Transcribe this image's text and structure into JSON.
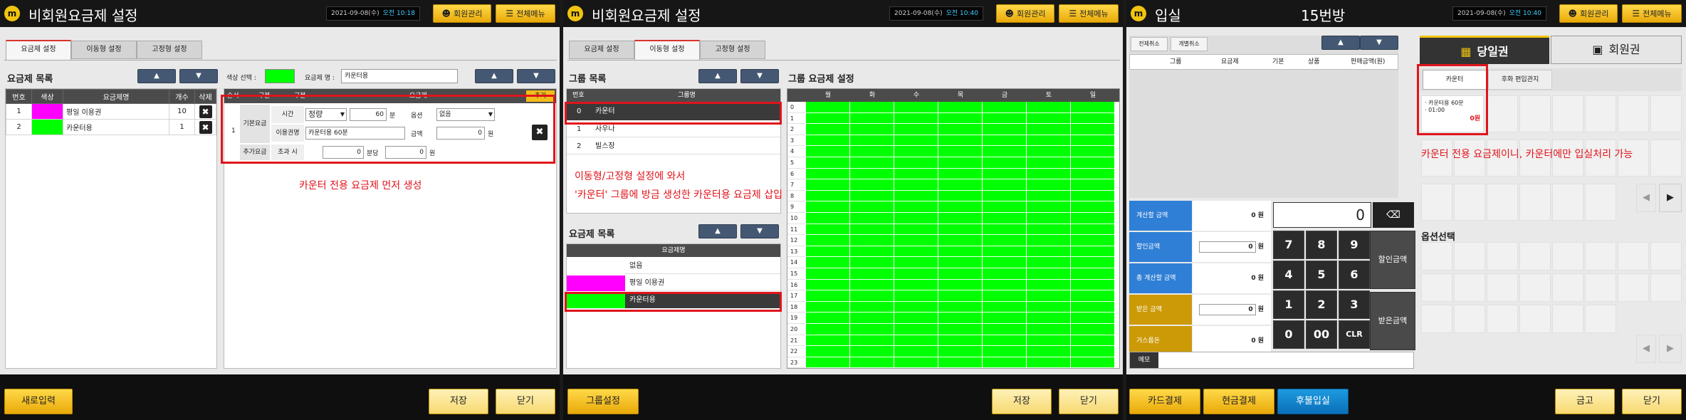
{
  "header": {
    "date": "2021-09-08(수)",
    "ampm": "오전",
    "btn_members": "회원관리",
    "btn_menu": "전체메뉴",
    "member_icon": "person-icon",
    "menu_icon": "hamburger-icon"
  },
  "p1": {
    "title": "비회원요금제 설정",
    "time": "10:18",
    "tabs": [
      "요금제 설정",
      "이동형 설정",
      "고정형 설정"
    ],
    "list_title": "요금제 목록",
    "list_headers": [
      "번호",
      "색상",
      "요금제명",
      "개수",
      "삭제"
    ],
    "list_rows": [
      {
        "no": "1",
        "color": "#ff00ff",
        "name": "평일 이용권",
        "count": "10"
      },
      {
        "no": "2",
        "color": "#00ff00",
        "name": "카운터용",
        "count": "1"
      }
    ],
    "color_label": "색상 선택 :",
    "color_value": "#00ff00",
    "name_label": "요금제 명 :",
    "name_value": "카운터용",
    "detail_headers": [
      "순서",
      "구분",
      "구분",
      "요금제"
    ],
    "add_btn": "추가",
    "row_no": "1",
    "base_fee": "기본요금",
    "time_label": "시간",
    "time_type": "정량",
    "time_value": "60",
    "time_unit": "분",
    "option_label": "옵션",
    "option_value": "없음",
    "name2_label": "이용권명",
    "name2_value": "카운터용 60분",
    "price_label": "금액",
    "price_value": "0",
    "won": "원",
    "extra_label": "추가요금",
    "over_label": "초과 시",
    "over_value": "0",
    "per_min": "분당",
    "extra_value": "0",
    "annotation": "카운터 전용 요금제 먼저 생성",
    "btn_new": "새로입력",
    "btn_save": "저장",
    "btn_close": "닫기"
  },
  "p2": {
    "title": "비회원요금제 설정",
    "time": "10:40",
    "tabs": [
      "요금제 설정",
      "이동형 설정",
      "고정형 설정"
    ],
    "group_title": "그룹 목록",
    "group_headers": [
      "번호",
      "그룹명"
    ],
    "groups": [
      {
        "no": "0",
        "name": "카운터"
      },
      {
        "no": "1",
        "name": "사우나"
      },
      {
        "no": "2",
        "name": "빌스장"
      }
    ],
    "sched_title": "그룹 요금제 설정",
    "days": [
      "월",
      "화",
      "수",
      "목",
      "금",
      "토",
      "일"
    ],
    "hours": [
      "0",
      "1",
      "2",
      "3",
      "4",
      "5",
      "6",
      "7",
      "8",
      "9",
      "10",
      "11",
      "12",
      "13",
      "14",
      "15",
      "16",
      "17",
      "18",
      "19",
      "20",
      "21",
      "22",
      "23"
    ],
    "grid_color": "#00ff00",
    "annotation1": "이동형/고정형 설정에 와서",
    "annotation2": "'카운터' 그룹에 방금 생성한 카운터용 요금제 삽입",
    "plan_title": "요금제 목록",
    "plan_header": "요금제명",
    "plans": [
      {
        "color": "#ffffff",
        "name": "없음"
      },
      {
        "color": "#ff00ff",
        "name": "평일 이용권"
      },
      {
        "color": "#00ff00",
        "name": "카운터용"
      }
    ],
    "btn_group": "그룹설정",
    "btn_save": "저장",
    "btn_close": "닫기"
  },
  "p3": {
    "title": "입실",
    "room": "15번방",
    "time": "10:40",
    "btn_cancel_all": "전체취소",
    "btn_cancel_one": "개별취소",
    "cart_headers": [
      "",
      "그룹",
      "요금제",
      "기본",
      "상품",
      "판매금액(원)"
    ],
    "tab_day": "당일권",
    "tab_member": "회원권",
    "ticket_icon": "ticket-icon",
    "card_icon": "card-icon",
    "sub_tabs": [
      "카운터",
      "후화 편입관지"
    ],
    "ticket_name": "· 카운터용 60분",
    "ticket_time": "· 01:00",
    "ticket_price": "0원",
    "annotation": "카운터 전용 요금제이니, 카운터에만 입실처리 가능",
    "pay_rows": [
      {
        "label": "계산할 금액",
        "value": "0",
        "unit": "원",
        "color": "#2f7fd6"
      },
      {
        "label": "할인금액",
        "value": "0",
        "unit": "원",
        "color": "#2f7fd6"
      },
      {
        "label": "총 계산할 금액",
        "value": "0",
        "unit": "원",
        "color": "#2f7fd6"
      },
      {
        "label": "받은 금액",
        "value": "0",
        "unit": "원",
        "color": "#cc9a06"
      },
      {
        "label": "거스름돈",
        "value": "0",
        "unit": "원",
        "color": "#cc9a06"
      }
    ],
    "display_value": "0",
    "keys": [
      "7",
      "8",
      "9",
      "4",
      "5",
      "6",
      "1",
      "2",
      "3",
      "0",
      "00",
      "CLR"
    ],
    "btn_discount": "할인금액",
    "btn_received": "받은금액",
    "memo": "메모",
    "option_title": "옵션선택",
    "btn_card": "카드결제",
    "btn_cash": "현금결제",
    "btn_later": "후불입실",
    "btn_hold": "금고",
    "btn_close": "닫기"
  }
}
